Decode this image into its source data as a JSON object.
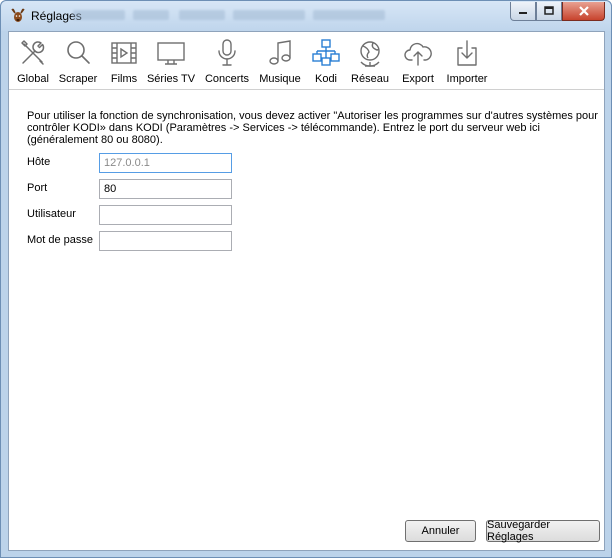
{
  "window": {
    "title": "Réglages"
  },
  "toolbar": {
    "items": [
      {
        "label": "Global",
        "icon": "wrench-screwdriver-icon"
      },
      {
        "label": "Scraper",
        "icon": "magnifier-icon"
      },
      {
        "label": "Films",
        "icon": "film-icon"
      },
      {
        "label": "Séries TV",
        "icon": "tv-icon"
      },
      {
        "label": "Concerts",
        "icon": "microphone-icon"
      },
      {
        "label": "Musique",
        "icon": "music-note-icon"
      },
      {
        "label": "Kodi",
        "icon": "network-boxes-icon"
      },
      {
        "label": "Réseau",
        "icon": "globe-icon"
      },
      {
        "label": "Export",
        "icon": "cloud-upload-icon"
      },
      {
        "label": "Importer",
        "icon": "import-icon"
      }
    ],
    "active": "Kodi",
    "active_color": "#2a7fd4"
  },
  "kodi": {
    "description": "Pour utiliser la fonction de synchronisation, vous devez activer \"Autoriser les programmes sur d'autres systèmes pour contrôler KODI» dans KODI (Paramètres -> Services -> télécommande). Entrez le port du serveur web ici (généralement 80 ou 8080).",
    "fields": {
      "host": {
        "label": "Hôte",
        "value": "",
        "placeholder": "127.0.0.1"
      },
      "port": {
        "label": "Port",
        "value": "80"
      },
      "user": {
        "label": "Utilisateur",
        "value": ""
      },
      "password": {
        "label": "Mot de passe",
        "value": ""
      }
    }
  },
  "buttons": {
    "cancel": "Annuler",
    "save": "Sauvegarder Réglages"
  }
}
